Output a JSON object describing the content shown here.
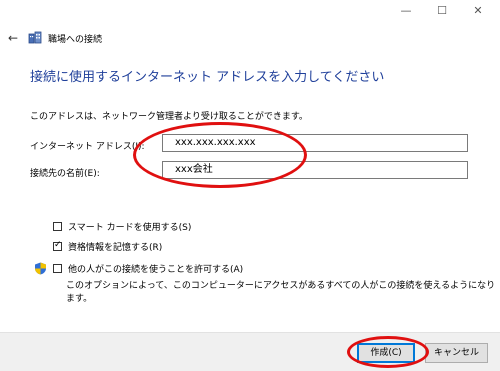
{
  "window": {
    "minimize": "—",
    "maximize": "☐",
    "close": "✕"
  },
  "header": {
    "back_icon": "←",
    "title": "職場への接続"
  },
  "main": {
    "heading": "接続に使用するインターネット アドレスを入力してください",
    "description": "このアドレスは、ネットワーク管理者より受け取ることができます。",
    "internet_address_label": "インターネット アドレス(I):",
    "internet_address_value": "xxx.xxx.xxx.xxx",
    "destination_name_label": "接続先の名前(E):",
    "destination_name_value": "xxx会社"
  },
  "options": {
    "smartcard_label": "スマート カードを使用する(S)",
    "smartcard_checked": false,
    "remember_label": "資格情報を記憶する(R)",
    "remember_checked": true,
    "allow_others_label": "他の人がこの接続を使うことを許可する(A)",
    "allow_others_checked": false,
    "allow_others_note": "このオプションによって、このコンピューターにアクセスがあるすべての人がこの接続を使えるようになります。"
  },
  "footer": {
    "create_label": "作成(C)",
    "cancel_label": "キャンセル"
  },
  "colors": {
    "heading": "#1f3f9a",
    "annotation": "#e01010",
    "accent": "#0078d7"
  }
}
